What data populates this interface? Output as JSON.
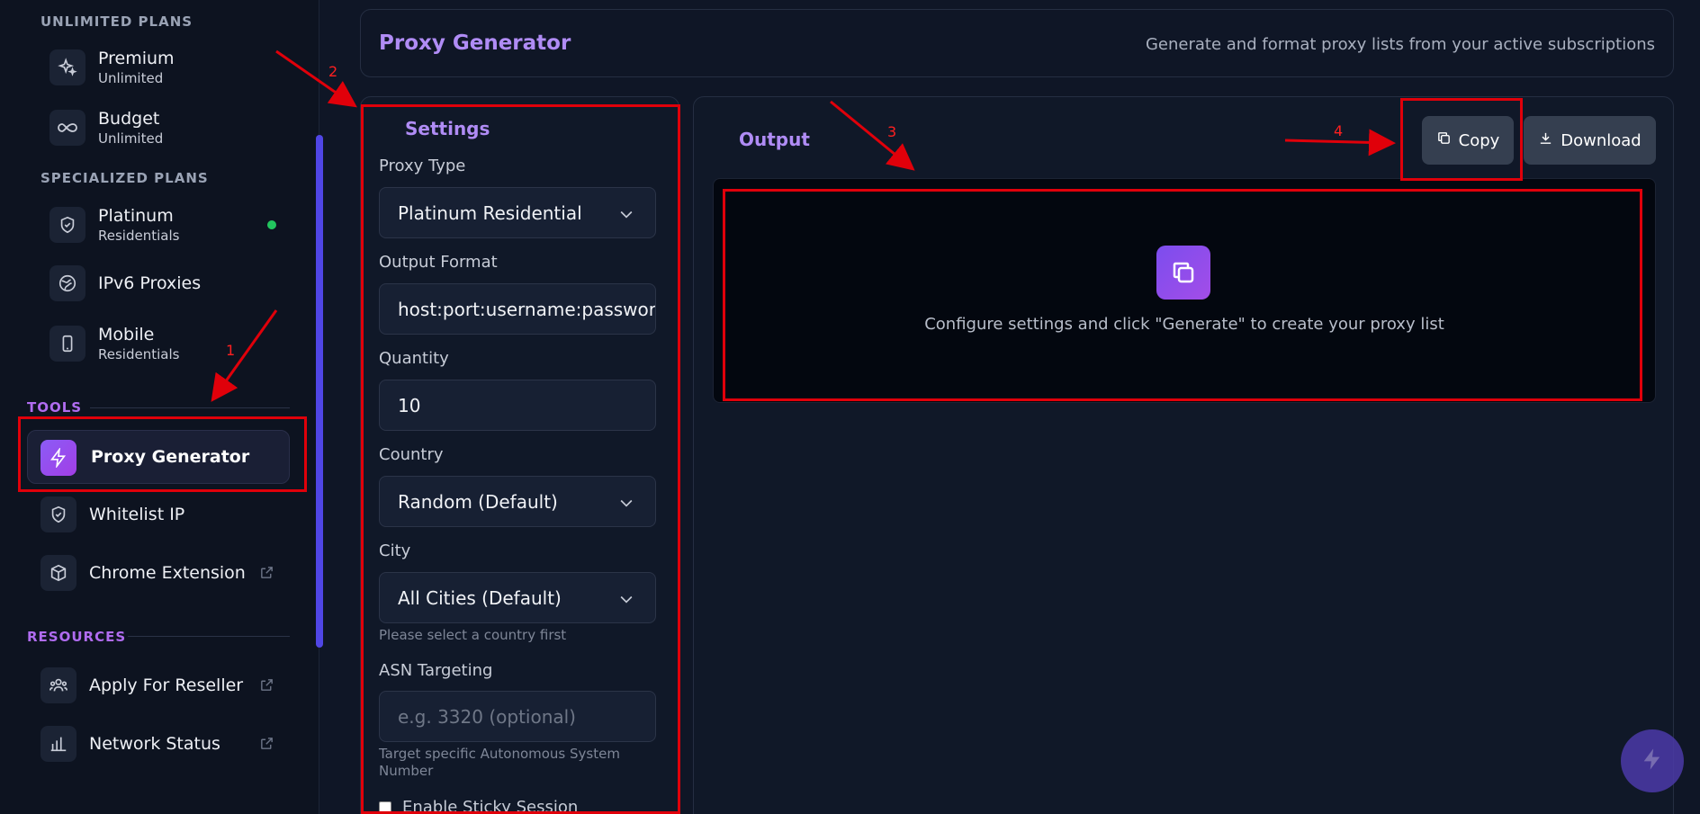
{
  "sidebar": {
    "sections": {
      "unlimited": "UNLIMITED PLANS",
      "specialized": "SPECIALIZED PLANS",
      "tools": "TOOLS",
      "resources": "RESOURCES"
    },
    "unlimited_items": [
      {
        "title": "Premium",
        "sub": "Unlimited",
        "icon": "sparkles-icon"
      },
      {
        "title": "Budget",
        "sub": "Unlimited",
        "icon": "infinity-icon"
      }
    ],
    "specialized_items": [
      {
        "title": "Platinum",
        "sub": "Residentials",
        "icon": "shield-check-icon"
      },
      {
        "title": "IPv6 Proxies",
        "icon": "globe-icon"
      },
      {
        "title": "Mobile",
        "sub": "Residentials",
        "icon": "smartphone-icon"
      }
    ],
    "tools_items": [
      {
        "title": "Proxy Generator",
        "icon": "lightning-icon"
      },
      {
        "title": "Whitelist IP",
        "icon": "shield-check-icon"
      },
      {
        "title": "Chrome Extension",
        "icon": "box-icon"
      }
    ],
    "resources_items": [
      {
        "title": "Apply For Reseller",
        "icon": "users-icon"
      },
      {
        "title": "Network Status",
        "icon": "bar-chart-icon"
      }
    ]
  },
  "header": {
    "title": "Proxy Generator",
    "subtitle": "Generate and format proxy lists from your active subscriptions"
  },
  "settings": {
    "title": "Settings",
    "proxy_type_label": "Proxy Type",
    "proxy_type_value": "Platinum Residential",
    "output_format_label": "Output Format",
    "output_format_value": "host:port:username:password",
    "quantity_label": "Quantity",
    "quantity_value": "10",
    "country_label": "Country",
    "country_value": "Random (Default)",
    "city_label": "City",
    "city_value": "All Cities (Default)",
    "city_help": "Please select a country first",
    "asn_label": "ASN Targeting",
    "asn_placeholder": "e.g. 3320 (optional)",
    "asn_help": "Target specific Autonomous System Number",
    "sticky_label": "Enable Sticky Session"
  },
  "output": {
    "title": "Output",
    "copy_label": "Copy",
    "download_label": "Download",
    "empty_text": "Configure settings and click \"Generate\" to create your proxy list"
  },
  "annotations": [
    "1",
    "2",
    "3",
    "4"
  ],
  "colors": {
    "accent": "#b08cf5",
    "annotation": "#e0000a",
    "status_online": "#22c55e"
  }
}
